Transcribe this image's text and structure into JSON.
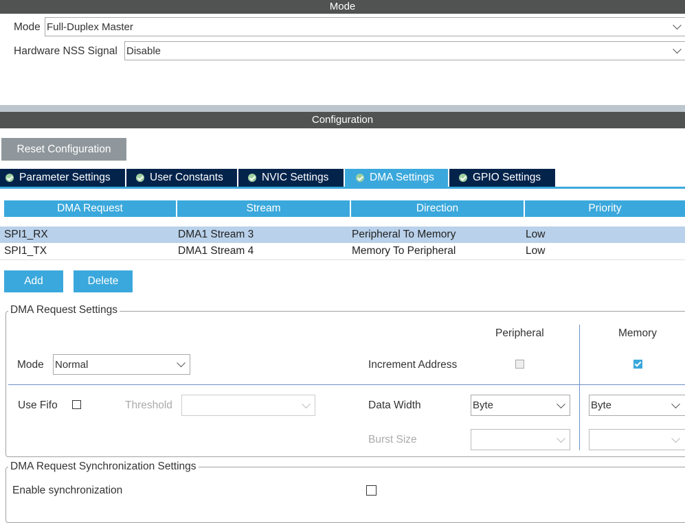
{
  "mode_section": {
    "title": "Mode",
    "mode_label": "Mode",
    "mode_value": "Full-Duplex Master",
    "nss_label": "Hardware NSS Signal",
    "nss_value": "Disable"
  },
  "config": {
    "title": "Configuration",
    "reset_label": "Reset Configuration",
    "tabs": [
      {
        "label": "Parameter Settings"
      },
      {
        "label": "User Constants"
      },
      {
        "label": "NVIC Settings"
      },
      {
        "label": "DMA Settings"
      },
      {
        "label": "GPIO Settings"
      }
    ],
    "active_tab": "DMA Settings"
  },
  "dma_table": {
    "headers": [
      "DMA Request",
      "Stream",
      "Direction",
      "Priority"
    ],
    "rows": [
      [
        "SPI1_RX",
        "DMA1 Stream 3",
        "Peripheral To Memory",
        "Low"
      ],
      [
        "SPI1_TX",
        "DMA1 Stream 4",
        "Memory To Peripheral",
        "Low"
      ]
    ],
    "add_label": "Add",
    "delete_label": "Delete"
  },
  "request_settings": {
    "title": "DMA Request Settings",
    "peripheral_label": "Peripheral",
    "memory_label": "Memory",
    "mode_label": "Mode",
    "mode_value": "Normal",
    "increment_label": "Increment Address",
    "inc_peripheral": false,
    "inc_memory": true,
    "fifo_label": "Use Fifo",
    "fifo_checked": false,
    "threshold_label": "Threshold",
    "threshold_value": "",
    "data_width_label": "Data Width",
    "pw_value": "Byte",
    "mw_value": "Byte",
    "burst_label": "Burst Size",
    "pburst_value": "",
    "mburst_value": ""
  },
  "sync_settings": {
    "title": "DMA Request Synchronization Settings",
    "enable_label": "Enable synchronization",
    "enabled": false
  },
  "colors": {
    "accent": "#3aa8dc",
    "tab_bg": "#03234b",
    "bar": "#505352"
  }
}
